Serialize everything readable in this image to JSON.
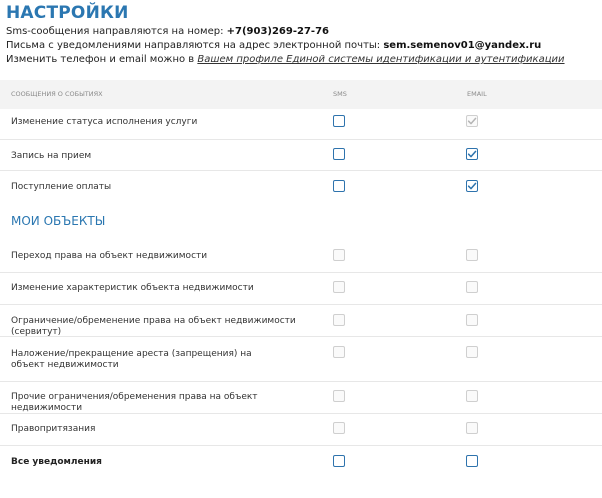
{
  "page": {
    "title": "НАСТРОЙКИ",
    "sms_prefix": "Sms-сообщения направляются на номер: ",
    "sms_phone": "+7(903)269-27-76",
    "email_prefix": "Письма с уведомлениями направляются на адрес электронной почты: ",
    "email_address": "sem.semenov01@yandex.ru",
    "profile_prefix": "Изменить телефон и email можно в ",
    "profile_link": "Вашем профиле Единой системы идентификации и аутентификации"
  },
  "table": {
    "col_events": "Сообщения о событиях",
    "col_sms": "SMS",
    "col_email": "EMAIL"
  },
  "events": [
    {
      "label": "Изменение статуса исполнения услуги",
      "sms": {
        "checked": false,
        "disabled": false
      },
      "email": {
        "checked": true,
        "disabled": true
      }
    },
    {
      "label": "Запись на прием",
      "sms": {
        "checked": false,
        "disabled": false
      },
      "email": {
        "checked": true,
        "disabled": false
      }
    },
    {
      "label": "Поступление оплаты",
      "sms": {
        "checked": false,
        "disabled": false
      },
      "email": {
        "checked": true,
        "disabled": false
      }
    }
  ],
  "objects_section": {
    "title": "МОИ ОБЪЕКТЫ",
    "rows": [
      {
        "label": "Переход права на объект недвижимости",
        "sms": {
          "checked": false,
          "disabled": true
        },
        "email": {
          "checked": false,
          "disabled": true
        }
      },
      {
        "label": "Изменение характеристик объекта недвижимости",
        "sms": {
          "checked": false,
          "disabled": true
        },
        "email": {
          "checked": false,
          "disabled": true
        }
      },
      {
        "label": "Ограничение/обременение права на объект недвижимости (сервитут)",
        "sms": {
          "checked": false,
          "disabled": true
        },
        "email": {
          "checked": false,
          "disabled": true
        }
      },
      {
        "label": "Наложение/прекращение ареста (запрещения) на объект недвижимости",
        "sms": {
          "checked": false,
          "disabled": true
        },
        "email": {
          "checked": false,
          "disabled": true
        }
      },
      {
        "label": "Прочие ограничения/обременения права на объект недвижимости",
        "sms": {
          "checked": false,
          "disabled": true
        },
        "email": {
          "checked": false,
          "disabled": true
        }
      },
      {
        "label": "Правопритязания",
        "sms": {
          "checked": false,
          "disabled": true
        },
        "email": {
          "checked": false,
          "disabled": true
        }
      }
    ]
  },
  "all_notifications": {
    "label": "Все уведомления",
    "sms": {
      "checked": false,
      "disabled": false
    },
    "email": {
      "checked": false,
      "disabled": false
    }
  },
  "colors": {
    "accent": "#2b77b1",
    "checkbox_border": "#2e73ad",
    "disabled_border": "#cfcfcf",
    "header_bg": "#f3f3f3"
  }
}
